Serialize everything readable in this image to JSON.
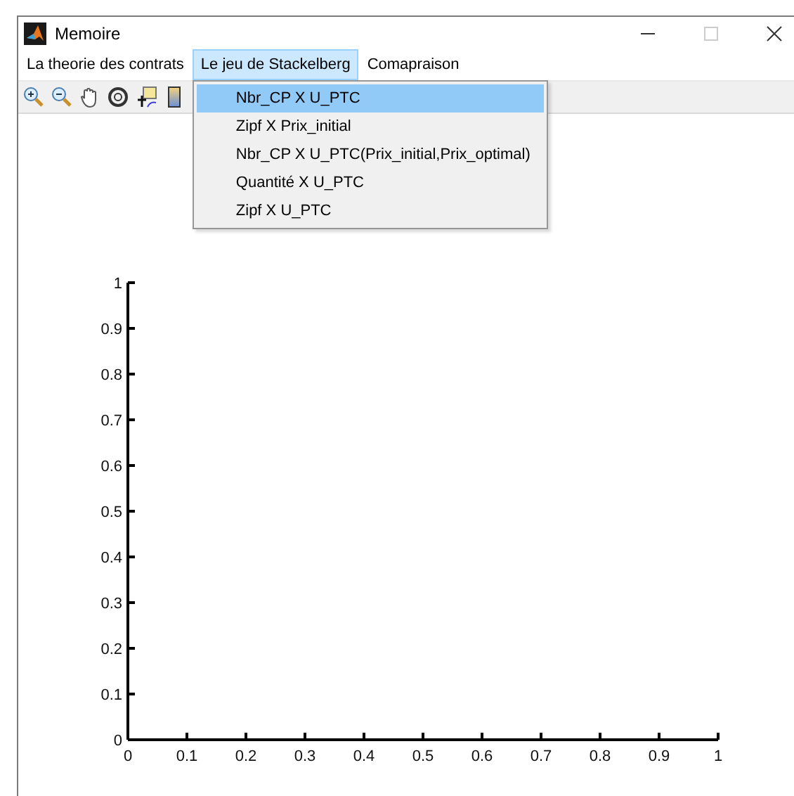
{
  "window": {
    "title": "Memoire"
  },
  "menu_bar": [
    {
      "label": "La theorie des contrats",
      "open": false
    },
    {
      "label": "Le jeu de Stackelberg",
      "open": true,
      "items": [
        {
          "label": "Nbr_CP X U_PTC",
          "selected": true
        },
        {
          "label": "Zipf X Prix_initial",
          "selected": false
        },
        {
          "label": "Nbr_CP X U_PTC(Prix_initial,Prix_optimal)",
          "selected": false
        },
        {
          "label": "Quantité X U_PTC",
          "selected": false
        },
        {
          "label": "Zipf X U_PTC",
          "selected": false
        }
      ]
    },
    {
      "label": "Comapraison",
      "open": false
    }
  ],
  "axes": {
    "chart_data": {
      "type": "line",
      "xlim": [
        0,
        1
      ],
      "ylim": [
        0,
        1
      ],
      "xticks": [
        0,
        0.1,
        0.2,
        0.3,
        0.4,
        0.5,
        0.6,
        0.7,
        0.8,
        0.9,
        1
      ],
      "yticks": [
        0,
        0.1,
        0.2,
        0.3,
        0.4,
        0.5,
        0.6,
        0.7,
        0.8,
        0.9,
        1
      ]
    }
  }
}
